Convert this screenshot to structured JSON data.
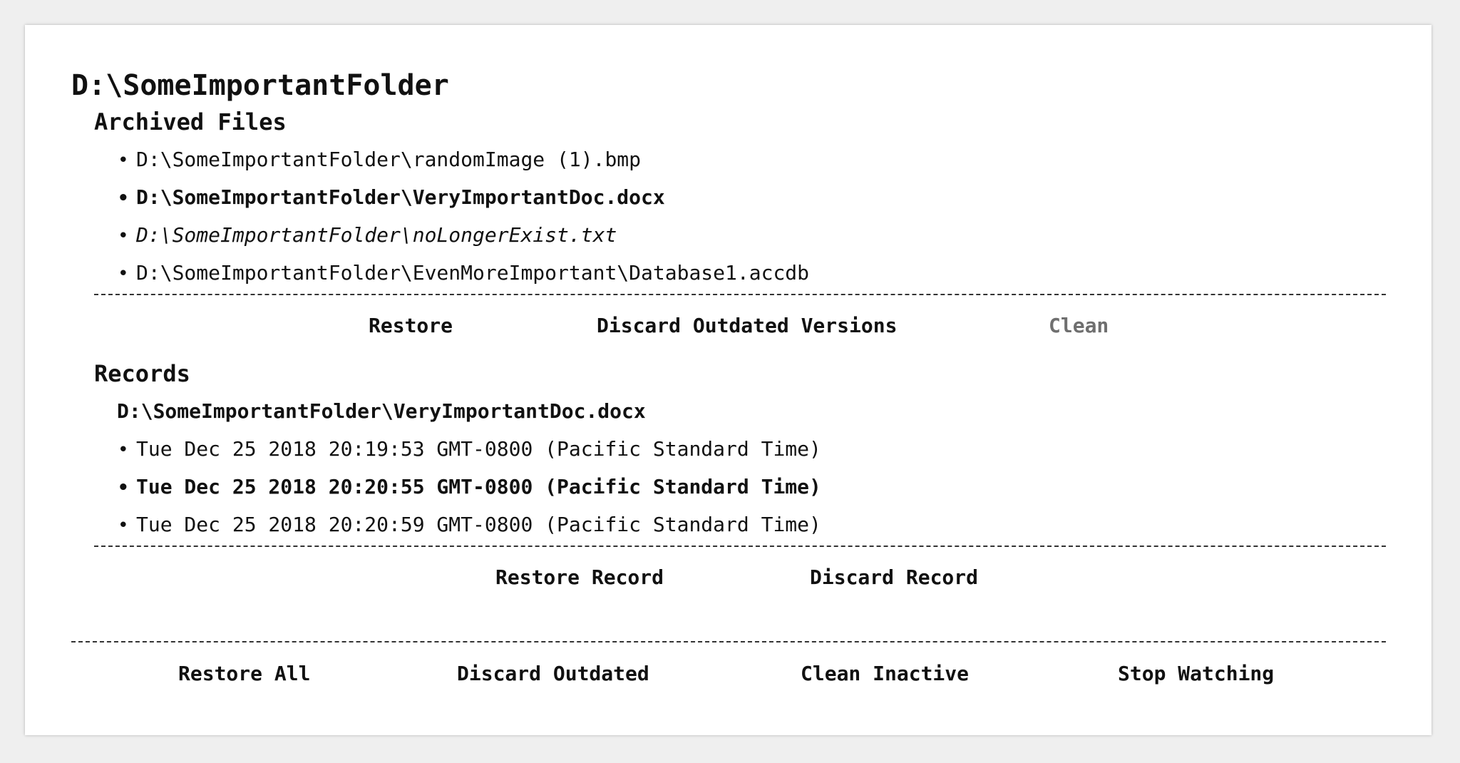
{
  "folder": {
    "path": "D:\\SomeImportantFolder"
  },
  "archived": {
    "title": "Archived Files",
    "files": [
      {
        "path": "D:\\SomeImportantFolder\\randomImage (1).bmp"
      },
      {
        "path": "D:\\SomeImportantFolder\\VeryImportantDoc.docx"
      },
      {
        "path": "D:\\SomeImportantFolder\\noLongerExist.txt"
      },
      {
        "path": "D:\\SomeImportantFolder\\EvenMoreImportant\\Database1.accdb"
      }
    ],
    "buttons": {
      "restore": "Restore",
      "discard_outdated_versions": "Discard Outdated Versions",
      "clean": "Clean"
    }
  },
  "records": {
    "title": "Records",
    "file": "D:\\SomeImportantFolder\\VeryImportantDoc.docx",
    "items": [
      {
        "timestamp": "Tue Dec 25 2018 20:19:53 GMT-0800 (Pacific Standard Time)"
      },
      {
        "timestamp": "Tue Dec 25 2018 20:20:55 GMT-0800 (Pacific Standard Time)"
      },
      {
        "timestamp": "Tue Dec 25 2018 20:20:59 GMT-0800 (Pacific Standard Time)"
      }
    ],
    "buttons": {
      "restore_record": "Restore Record",
      "discard_record": "Discard Record"
    }
  },
  "footer": {
    "restore_all": "Restore All",
    "discard_outdated": "Discard Outdated",
    "clean_inactive": "Clean Inactive",
    "stop_watching": "Stop Watching"
  },
  "bullet": "•"
}
